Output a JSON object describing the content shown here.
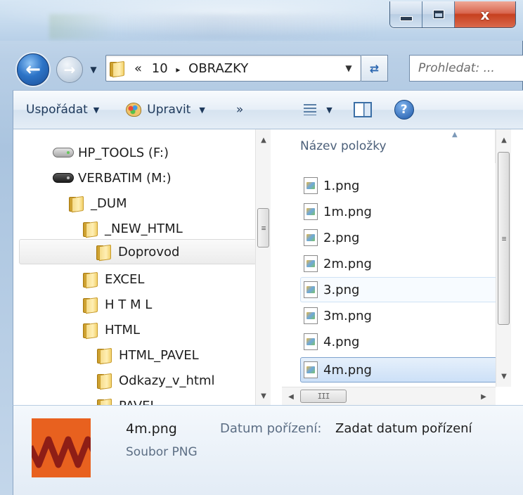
{
  "window": {
    "close_glyph": "x",
    "accent_close": "#c7401f"
  },
  "address_bar": {
    "path_prefix": "«",
    "path_segments": [
      "10",
      "OBRAZKY"
    ],
    "separator": "▸",
    "search_placeholder": "Prohledat: ..."
  },
  "toolbar": {
    "organize_label": "Uspořádat",
    "edit_label": "Upravit",
    "more_label": "»"
  },
  "navigation_pane": {
    "items": [
      {
        "label": "HP_TOOLS (F:)",
        "icon": "drive-icon"
      },
      {
        "label": "VERBATIM (M:)",
        "icon": "drive-icon"
      },
      {
        "label": "_DUM",
        "icon": "folder-icon"
      },
      {
        "label": "_NEW_HTML",
        "icon": "folder-icon"
      },
      {
        "label": "Doprovod",
        "icon": "folder-icon",
        "selected": true
      },
      {
        "label": "EXCEL",
        "icon": "folder-icon"
      },
      {
        "label": "H T M L",
        "icon": "folder-icon"
      },
      {
        "label": "HTML",
        "icon": "folder-icon"
      },
      {
        "label": "HTML_PAVEL",
        "icon": "folder-icon"
      },
      {
        "label": "Odkazy_v_html",
        "icon": "folder-icon"
      },
      {
        "label": "PAVEL",
        "icon": "folder-icon"
      }
    ]
  },
  "file_list": {
    "column_header": "Název položky",
    "files": [
      {
        "name": "1.png",
        "state": "normal"
      },
      {
        "name": "1m.png",
        "state": "normal"
      },
      {
        "name": "2.png",
        "state": "normal"
      },
      {
        "name": "2m.png",
        "state": "normal"
      },
      {
        "name": "3.png",
        "state": "hover"
      },
      {
        "name": "3m.png",
        "state": "normal"
      },
      {
        "name": "4.png",
        "state": "normal"
      },
      {
        "name": "4m.png",
        "state": "selected"
      }
    ]
  },
  "details_pane": {
    "file_name": "4m.png",
    "file_type": "Soubor PNG",
    "date_label": "Datum pořízení:",
    "date_value": "Zadat datum pořízení"
  }
}
